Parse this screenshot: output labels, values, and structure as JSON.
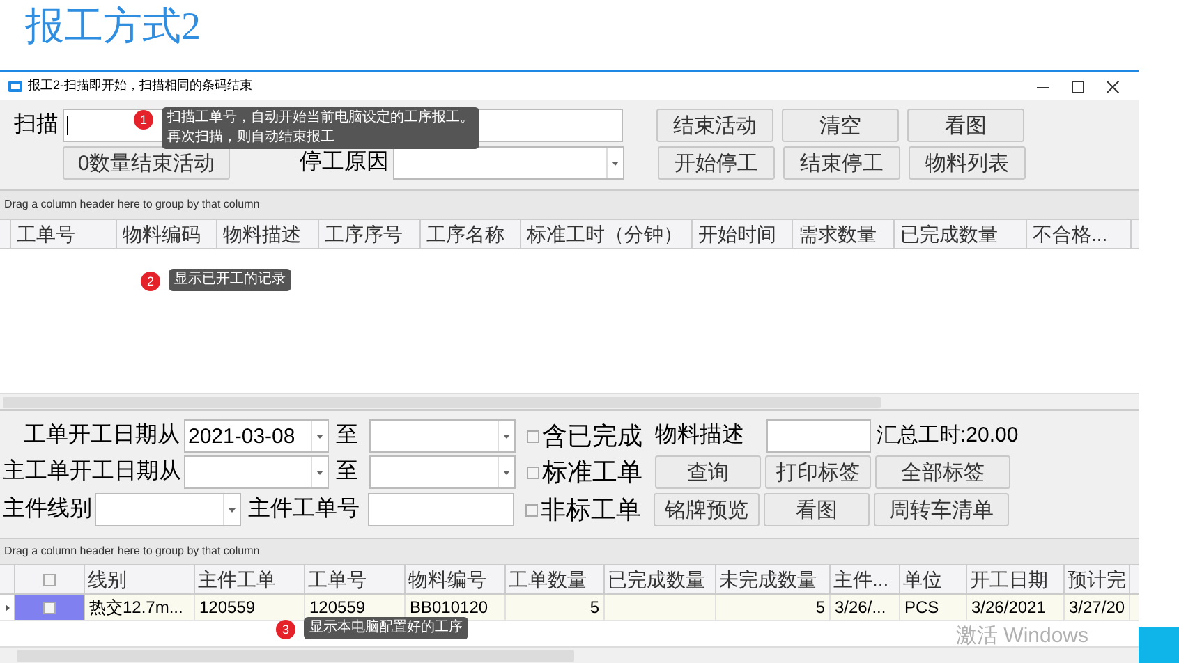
{
  "page_title": "报工方式2",
  "window": {
    "title": "报工2-扫描即开始，扫描相同的条码结束"
  },
  "scan": {
    "label": "扫描"
  },
  "buttons_row1": [
    "结束活动",
    "清空",
    "看图"
  ],
  "zero_qty_button": "0数量结束活动",
  "stop_reason_label": "停工原因",
  "buttons_row2": [
    "开始停工",
    "结束停工",
    "物料列表"
  ],
  "upper_grid": {
    "group_hint": "Drag a column header here to group by that column",
    "columns": [
      "工单号",
      "物料编码",
      "物料描述",
      "工序序号",
      "工序名称",
      "标准工时（分钟）",
      "开始时间",
      "需求数量",
      "已完成数量",
      "不合格..."
    ]
  },
  "filters": {
    "start_date_label": "工单开工日期从",
    "start_date_value": "2021-03-08",
    "to_label_1": "至",
    "main_start_label": "主工单开工日期从",
    "to_label_2": "至",
    "line_label": "主件线别",
    "main_order_label": "主件工单号",
    "checkboxes": [
      {
        "label": "含已完成",
        "checked": false
      },
      {
        "label": "标准工单",
        "checked": false
      },
      {
        "label": "非标工单",
        "checked": false
      }
    ],
    "material_desc_label": "物料描述",
    "total_hours": "汇总工时:20.00",
    "buttons": [
      [
        "查询",
        "打印标签",
        "全部标签"
      ],
      [
        "铭牌预览",
        "看图",
        "周转车清单"
      ]
    ]
  },
  "lower_grid": {
    "group_hint": "Drag a column header here to group by that column",
    "header_checked": false,
    "columns": [
      "线别",
      "主件工单",
      "工单号",
      "物料编号",
      "工单数量",
      "已完成数量",
      "未完成数量",
      "主件...",
      "单位",
      "开工日期",
      "预计完"
    ],
    "rows": [
      {
        "selected": true,
        "checked": false,
        "cells": [
          "热交12.7m...",
          "120559",
          "120559",
          "BB010120",
          "5",
          null,
          "5",
          "3/26/...",
          "PCS",
          "3/26/2021",
          "3/27/20"
        ]
      }
    ]
  },
  "callouts": [
    {
      "number": "1",
      "lines": [
        "扫描工单号，自动开始当前电脑设定的工序报工。",
        "再次扫描，则自动结束报工"
      ]
    },
    {
      "number": "2",
      "lines": [
        "显示已开工的记录"
      ]
    },
    {
      "number": "3",
      "lines": [
        "显示本电脑配置好的工序"
      ]
    }
  ],
  "activation_notice": "激活 Windows"
}
